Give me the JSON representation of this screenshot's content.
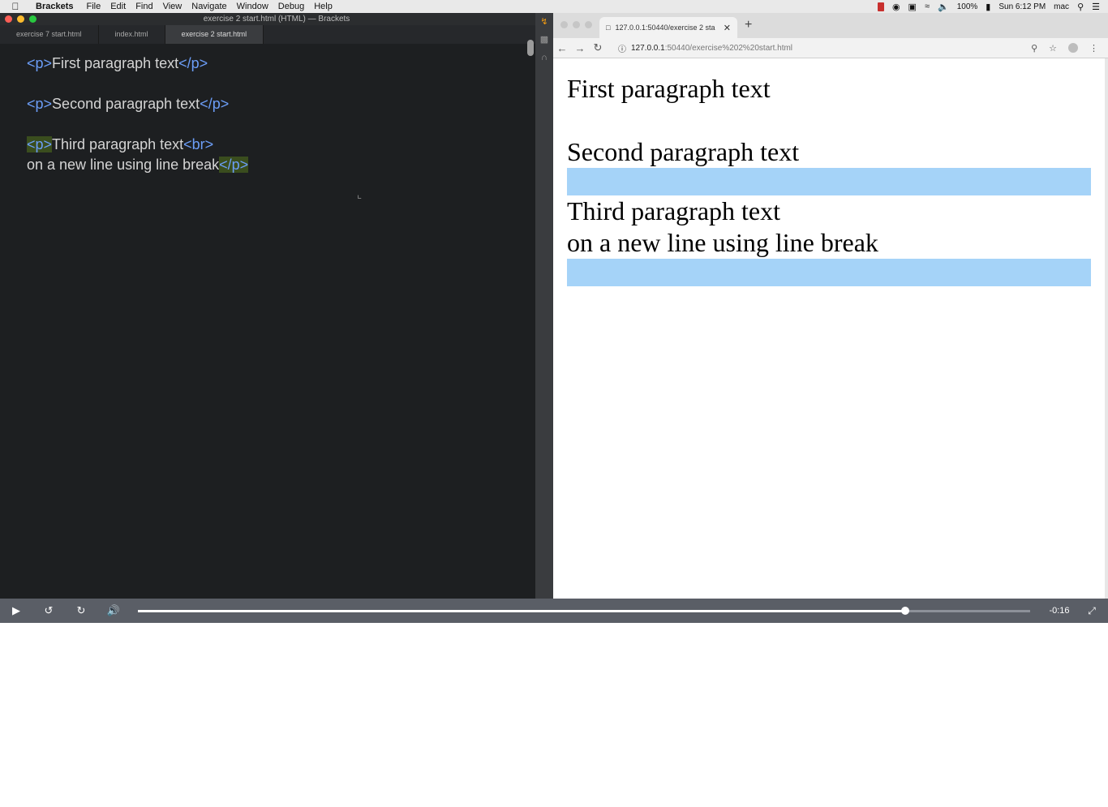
{
  "menubar": {
    "app_name": "Brackets",
    "menus": [
      "File",
      "Edit",
      "Find",
      "View",
      "Navigate",
      "Window",
      "Debug",
      "Help"
    ],
    "battery": "100%",
    "clock": "Sun 6:12 PM",
    "user": "mac"
  },
  "editor": {
    "window_title": "exercise 2 start.html (HTML) — Brackets",
    "tabs": [
      {
        "label": "exercise 7 start.html",
        "active": false
      },
      {
        "label": "index.html",
        "active": false
      },
      {
        "label": "exercise 2 start.html",
        "active": true
      }
    ],
    "code": {
      "line1_open": "<p>",
      "line1_text": "First paragraph text",
      "line1_close": "</p>",
      "line2_open": "<p>",
      "line2_text": "Second paragraph text",
      "line2_close": "</p>",
      "line3_open": "<p>",
      "line3_text": "Third paragraph text",
      "line3_br": "<br>",
      "line4_text": "on a new line using line break",
      "line4_close": "</p>"
    }
  },
  "browser": {
    "tab_title": "127.0.0.1:50440/exercise 2 sta",
    "url_host": "127.0.0.1",
    "url_path": ":50440/exercise%202%20start.html",
    "page": {
      "p1": "First paragraph text",
      "p2": "Second paragraph text",
      "p3_line1": "Third paragraph text",
      "p3_line2": "on a new line using line break"
    }
  },
  "player": {
    "time_remaining": "-0:16",
    "progress_fraction": 0.86
  },
  "colors": {
    "tag_blue": "#6c9ef8",
    "match_highlight": "#3a4d1e",
    "selection_blue": "#a5d3f8"
  }
}
